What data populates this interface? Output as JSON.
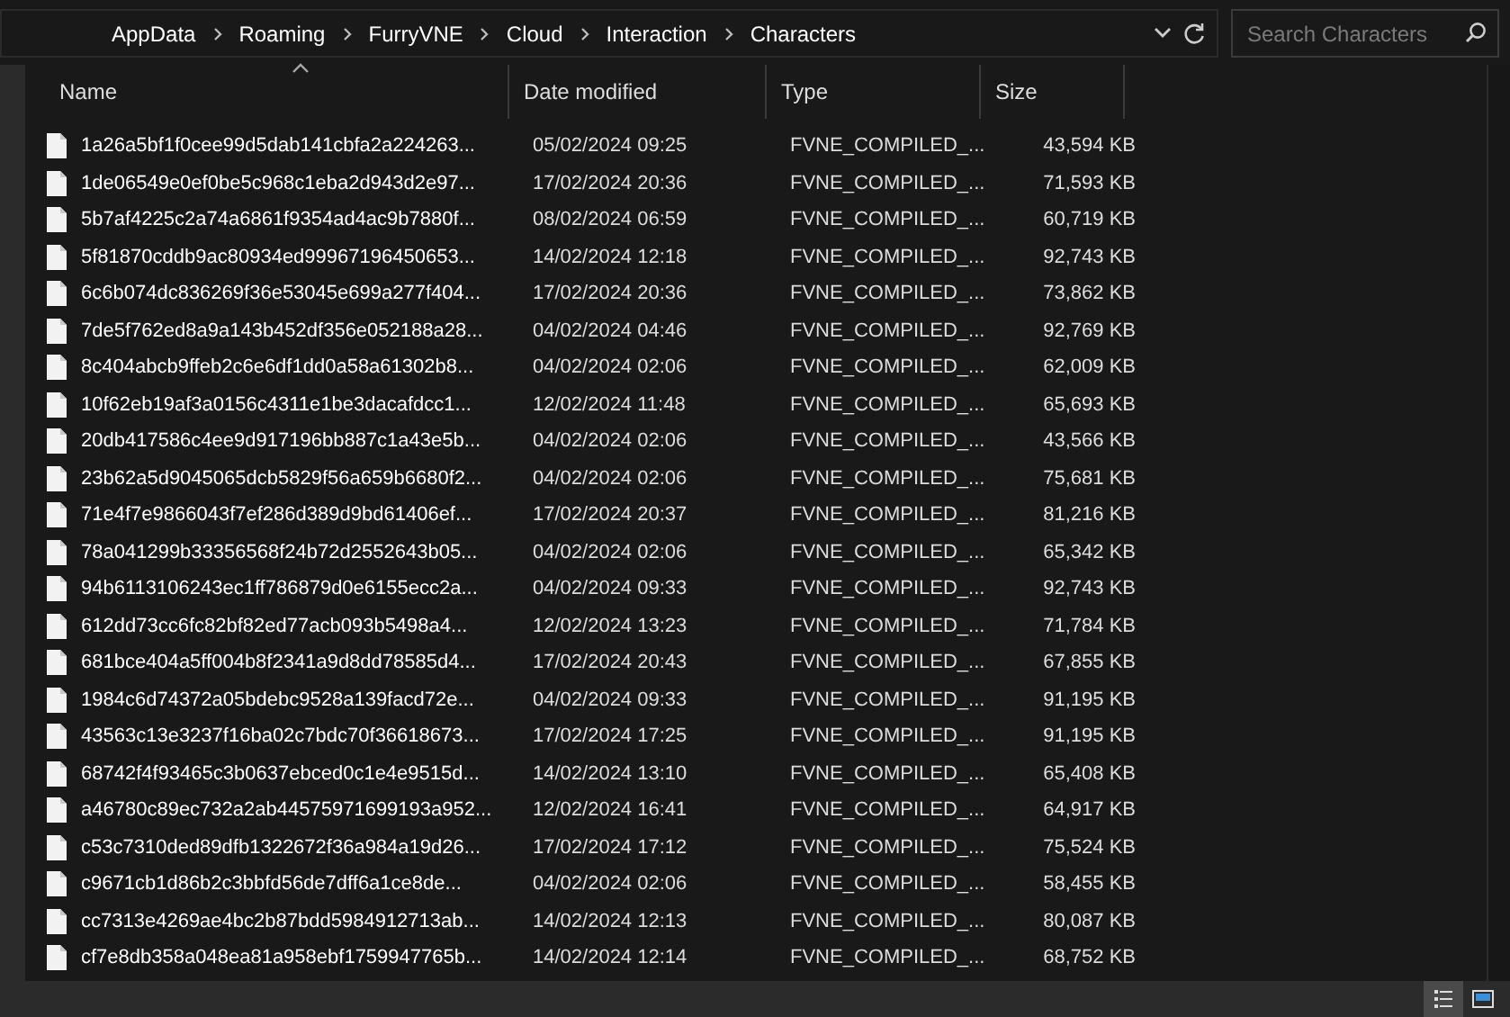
{
  "address_bar": {
    "breadcrumbs": [
      "AppData",
      "Roaming",
      "FurryVNE",
      "Cloud",
      "Interaction",
      "Characters"
    ]
  },
  "search": {
    "placeholder": "Search Characters"
  },
  "table": {
    "columns": [
      {
        "label": "Name",
        "sorted": true
      },
      {
        "label": "Date modified",
        "sorted": false
      },
      {
        "label": "Type",
        "sorted": false
      },
      {
        "label": "Size",
        "sorted": false
      }
    ],
    "rows": [
      {
        "name": "1a26a5bf1f0cee99d5dab141cbfa2a224263...",
        "date": "05/02/2024 09:25",
        "type": "FVNE_COMPILED_...",
        "size": "43,594 KB"
      },
      {
        "name": "1de06549e0ef0be5c968c1eba2d943d2e97...",
        "date": "17/02/2024 20:36",
        "type": "FVNE_COMPILED_...",
        "size": "71,593 KB"
      },
      {
        "name": "5b7af4225c2a74a6861f9354ad4ac9b7880f...",
        "date": "08/02/2024 06:59",
        "type": "FVNE_COMPILED_...",
        "size": "60,719 KB"
      },
      {
        "name": "5f81870cddb9ac80934ed99967196450653...",
        "date": "14/02/2024 12:18",
        "type": "FVNE_COMPILED_...",
        "size": "92,743 KB"
      },
      {
        "name": "6c6b074dc836269f36e53045e699a277f404...",
        "date": "17/02/2024 20:36",
        "type": "FVNE_COMPILED_...",
        "size": "73,862 KB"
      },
      {
        "name": "7de5f762ed8a9a143b452df356e052188a28...",
        "date": "04/02/2024 04:46",
        "type": "FVNE_COMPILED_...",
        "size": "92,769 KB"
      },
      {
        "name": "8c404abcb9ffeb2c6e6df1dd0a58a61302b8...",
        "date": "04/02/2024 02:06",
        "type": "FVNE_COMPILED_...",
        "size": "62,009 KB"
      },
      {
        "name": "10f62eb19af3a0156c4311e1be3dacafdcc1...",
        "date": "12/02/2024 11:48",
        "type": "FVNE_COMPILED_...",
        "size": "65,693 KB"
      },
      {
        "name": "20db417586c4ee9d917196bb887c1a43e5b...",
        "date": "04/02/2024 02:06",
        "type": "FVNE_COMPILED_...",
        "size": "43,566 KB"
      },
      {
        "name": "23b62a5d9045065dcb5829f56a659b6680f2...",
        "date": "04/02/2024 02:06",
        "type": "FVNE_COMPILED_...",
        "size": "75,681 KB"
      },
      {
        "name": "71e4f7e9866043f7ef286d389d9bd61406ef...",
        "date": "17/02/2024 20:37",
        "type": "FVNE_COMPILED_...",
        "size": "81,216 KB"
      },
      {
        "name": "78a041299b33356568f24b72d2552643b05...",
        "date": "04/02/2024 02:06",
        "type": "FVNE_COMPILED_...",
        "size": "65,342 KB"
      },
      {
        "name": "94b6113106243ec1ff786879d0e6155ecc2a...",
        "date": "04/02/2024 09:33",
        "type": "FVNE_COMPILED_...",
        "size": "92,743 KB"
      },
      {
        "name": "612dd73cc6fc82bf82ed77acb093b5498a4...",
        "date": "12/02/2024 13:23",
        "type": "FVNE_COMPILED_...",
        "size": "71,784 KB"
      },
      {
        "name": "681bce404a5ff004b8f2341a9d8dd78585d4...",
        "date": "17/02/2024 20:43",
        "type": "FVNE_COMPILED_...",
        "size": "67,855 KB"
      },
      {
        "name": "1984c6d74372a05bdebc9528a139facd72e...",
        "date": "04/02/2024 09:33",
        "type": "FVNE_COMPILED_...",
        "size": "91,195 KB"
      },
      {
        "name": "43563c13e3237f16ba02c7bdc70f36618673...",
        "date": "17/02/2024 17:25",
        "type": "FVNE_COMPILED_...",
        "size": "91,195 KB"
      },
      {
        "name": "68742f4f93465c3b0637ebced0c1e4e9515d...",
        "date": "14/02/2024 13:10",
        "type": "FVNE_COMPILED_...",
        "size": "65,408 KB"
      },
      {
        "name": "a46780c89ec732a2ab44575971699193a952...",
        "date": "12/02/2024 16:41",
        "type": "FVNE_COMPILED_...",
        "size": "64,917 KB"
      },
      {
        "name": "c53c7310ded89dfb1322672f36a984a19d26...",
        "date": "17/02/2024 17:12",
        "type": "FVNE_COMPILED_...",
        "size": "75,524 KB"
      },
      {
        "name": "c9671cb1d86b2c3bbfd56de7dff6a1ce8de...",
        "date": "04/02/2024 02:06",
        "type": "FVNE_COMPILED_...",
        "size": "58,455 KB"
      },
      {
        "name": "cc7313e4269ae4bc2b87bdd5984912713ab...",
        "date": "14/02/2024 12:13",
        "type": "FVNE_COMPILED_...",
        "size": "80,087 KB"
      },
      {
        "name": "cf7e8db358a048ea81a958ebf1759947765b...",
        "date": "14/02/2024 12:14",
        "type": "FVNE_COMPILED_...",
        "size": "68,752 KB"
      }
    ]
  },
  "status_bar": {
    "views": [
      {
        "selected": true
      },
      {
        "selected": false
      }
    ]
  }
}
